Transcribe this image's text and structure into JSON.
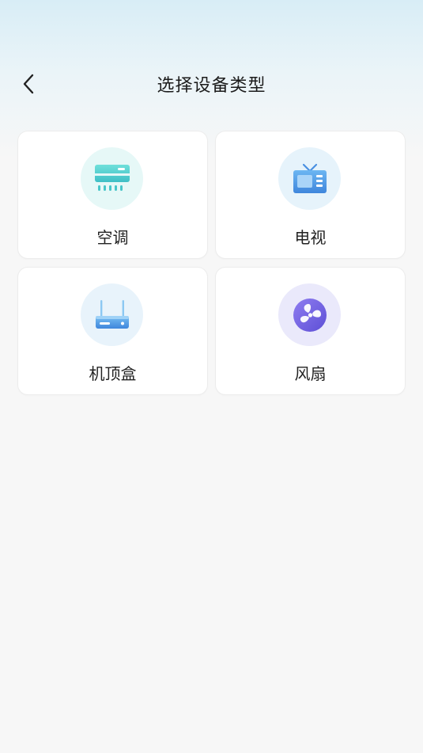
{
  "header": {
    "title": "选择设备类型",
    "back_icon": "chevron-left-icon"
  },
  "devices": [
    {
      "label": "空调",
      "icon": "air-conditioner-icon",
      "circle_color": "#e6f8f7"
    },
    {
      "label": "电视",
      "icon": "tv-icon",
      "circle_color": "#e6f3fb"
    },
    {
      "label": "机顶盒",
      "icon": "set-top-box-icon",
      "circle_color": "#e8f3fb"
    },
    {
      "label": "风扇",
      "icon": "fan-icon",
      "circle_color": "#eae9fb"
    }
  ]
}
